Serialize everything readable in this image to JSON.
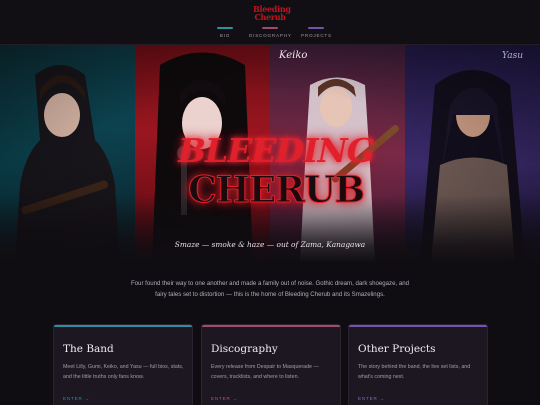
{
  "nav": {
    "logo_line1": "Bleeding",
    "logo_line2": "Cherub",
    "items": [
      {
        "label": "BIO",
        "color": "#2f8ea2"
      },
      {
        "label": "DISCOGRAPHY",
        "color": "#9b4b6d"
      },
      {
        "label": "PROJECTS",
        "color": "#6f54a8"
      }
    ]
  },
  "hero": {
    "name_tags": [
      "Keiko",
      "Yasu"
    ],
    "title_line1": "BLEEDING",
    "title_line2": "CHERUB",
    "tagline": "Smaze — smoke & haze — out of Zama, Kanagawa",
    "panels": [
      "teal",
      "red",
      "rose",
      "violet"
    ]
  },
  "intro": "Four found their way to one another and made a family out of noise. Gothic dream, dark shoegaze, and fairy tales set to distortion — this is the home of Bleeding Cherub and its Smazelings.",
  "cards": [
    {
      "title": "The Band",
      "desc": "Meet Lilly, Gumi, Keiko, and Yasu — full bios, stats, and the little truths only fans know.",
      "link": "ENTER →",
      "accent": "#2f8ea2"
    },
    {
      "title": "Discography",
      "desc": "Every release from Despair to Masquerade — covers, tracklists, and where to listen.",
      "link": "ENTER →",
      "accent": "#a44b72"
    },
    {
      "title": "Other Projects",
      "desc": "The story behind the band, the live set lists, and what's coming next.",
      "link": "ENTER →",
      "accent": "#7553b0"
    }
  ]
}
